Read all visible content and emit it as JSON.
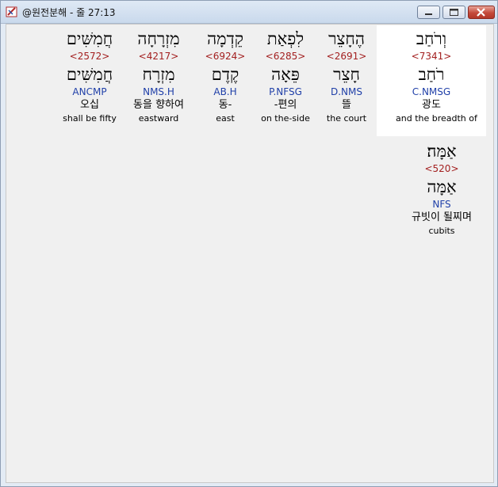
{
  "window": {
    "title": "@원전분해 - 줄 27:13"
  },
  "words": [
    {
      "hebrew": "וְרֹחַב",
      "strong": "<7341>",
      "lemma": "רֹחַב",
      "parse": "C.NMSG",
      "korean": "광도",
      "english": "and the breadth of"
    },
    {
      "hebrew": "הֶחָצֵר",
      "strong": "<2691>",
      "lemma": "חָצֵר",
      "parse": "D.NMS",
      "korean": "뜰",
      "english": "the court"
    },
    {
      "hebrew": "לִפְאַת",
      "strong": "<6285>",
      "lemma": "פֵּאָה",
      "parse": "P.NFSG",
      "korean": "-편의",
      "english": "on the-side"
    },
    {
      "hebrew": "קֵדְמָה",
      "strong": "<6924>",
      "lemma": "קֶדֶם",
      "parse": "AB.H",
      "korean": "동-",
      "english": "east"
    },
    {
      "hebrew": "מִזְרָחָה",
      "strong": "<4217>",
      "lemma": "מִזְרָח",
      "parse": "NMS.H",
      "korean": "동을 향하여",
      "english": "eastward"
    },
    {
      "hebrew": "חֲמִשִּׁים",
      "strong": "<2572>",
      "lemma": "חֲמִשִּׁים",
      "parse": "ANCMP",
      "korean": "오십",
      "english": "shall be fifty"
    },
    {
      "hebrew": "אַמָּה׃",
      "strong": "<520>",
      "lemma": "אַמָּה",
      "parse": "NFS",
      "korean": "규빗이 될찌며",
      "english": "cubits"
    }
  ]
}
